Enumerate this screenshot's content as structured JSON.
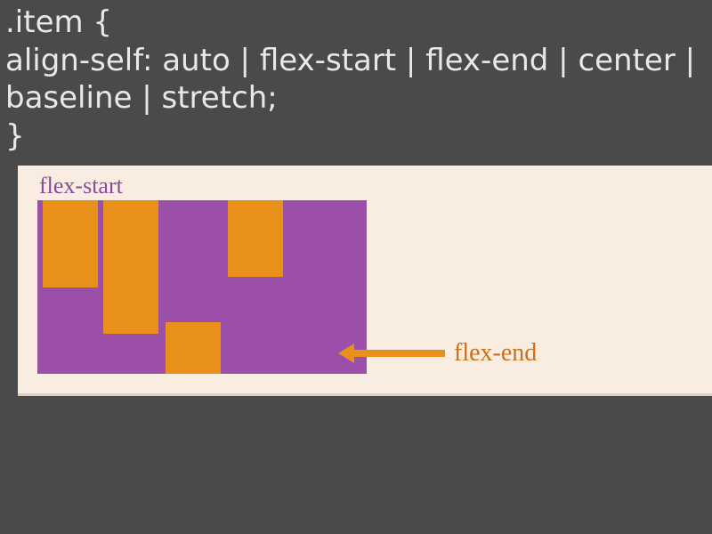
{
  "code": {
    "line1": ".item {",
    "line2": " align-self: auto | flex-start | flex-end | center | baseline | stretch;",
    "line3": "}"
  },
  "diagram": {
    "label_top": "flex-start",
    "label_end": "flex-end",
    "container_color": "#9b4fa8",
    "item_color": "#e8901a",
    "background_color": "#f9ece0",
    "items": [
      {
        "align": "flex-start"
      },
      {
        "align": "flex-start"
      },
      {
        "align": "flex-end"
      },
      {
        "align": "flex-start"
      }
    ]
  }
}
